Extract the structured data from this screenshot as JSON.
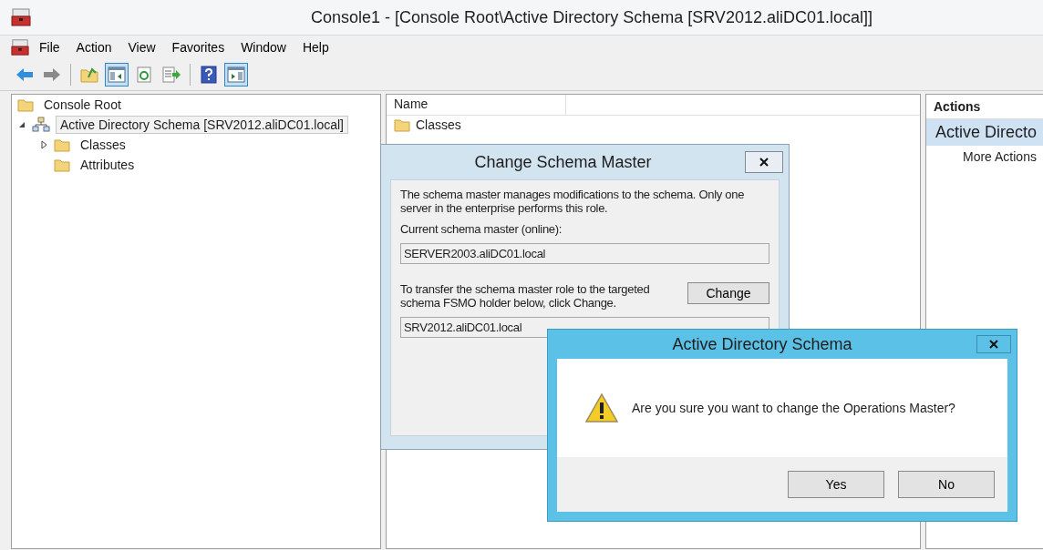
{
  "window": {
    "title": "Console1 - [Console Root\\Active Directory Schema [SRV2012.aliDC01.local]]"
  },
  "menu": [
    "File",
    "Action",
    "View",
    "Favorites",
    "Window",
    "Help"
  ],
  "toolbar": [
    {
      "buttons": [
        {
          "kind": "back",
          "pressed": false
        },
        {
          "kind": "forward",
          "pressed": false
        }
      ]
    },
    {
      "buttons": [
        {
          "kind": "up",
          "pressed": false
        },
        {
          "kind": "tree",
          "pressed": true
        },
        {
          "kind": "refresh",
          "pressed": false
        },
        {
          "kind": "export",
          "pressed": false
        }
      ]
    },
    {
      "buttons": [
        {
          "kind": "help",
          "pressed": false
        },
        {
          "kind": "actionpane",
          "pressed": true
        }
      ]
    }
  ],
  "tree": [
    {
      "label": "Console Root",
      "kind": "folder",
      "selected": false,
      "children": [
        {
          "label": "Active Directory Schema [SRV2012.aliDC01.local]",
          "kind": "snapin",
          "selected": true,
          "expanded": true,
          "children": [
            {
              "label": "Classes",
              "kind": "folder",
              "selected": false,
              "expanded": false
            },
            {
              "label": "Attributes",
              "kind": "folder",
              "selected": false
            }
          ]
        }
      ]
    }
  ],
  "center": {
    "columns": [
      "Name"
    ],
    "items": [
      "Classes"
    ]
  },
  "actions": {
    "title": "Actions",
    "section": "Active Directo",
    "items": [
      "More Actions"
    ]
  },
  "change_dialog": {
    "title": "Change Schema Master",
    "description": "The schema master manages modifications to the schema. Only one server in the enterprise performs this role.",
    "current_label": "Current schema master (online):",
    "current_value": "SERVER2003.aliDC01.local",
    "transfer_text": "To transfer the schema master role to the targeted schema FSMO holder below, click Change.",
    "change_button": "Change",
    "target_value": "SRV2012.aliDC01.local"
  },
  "confirm_dialog": {
    "title": "Active Directory Schema",
    "message": "Are you sure you want to change the Operations Master?",
    "buttons": [
      "Yes",
      "No"
    ]
  }
}
